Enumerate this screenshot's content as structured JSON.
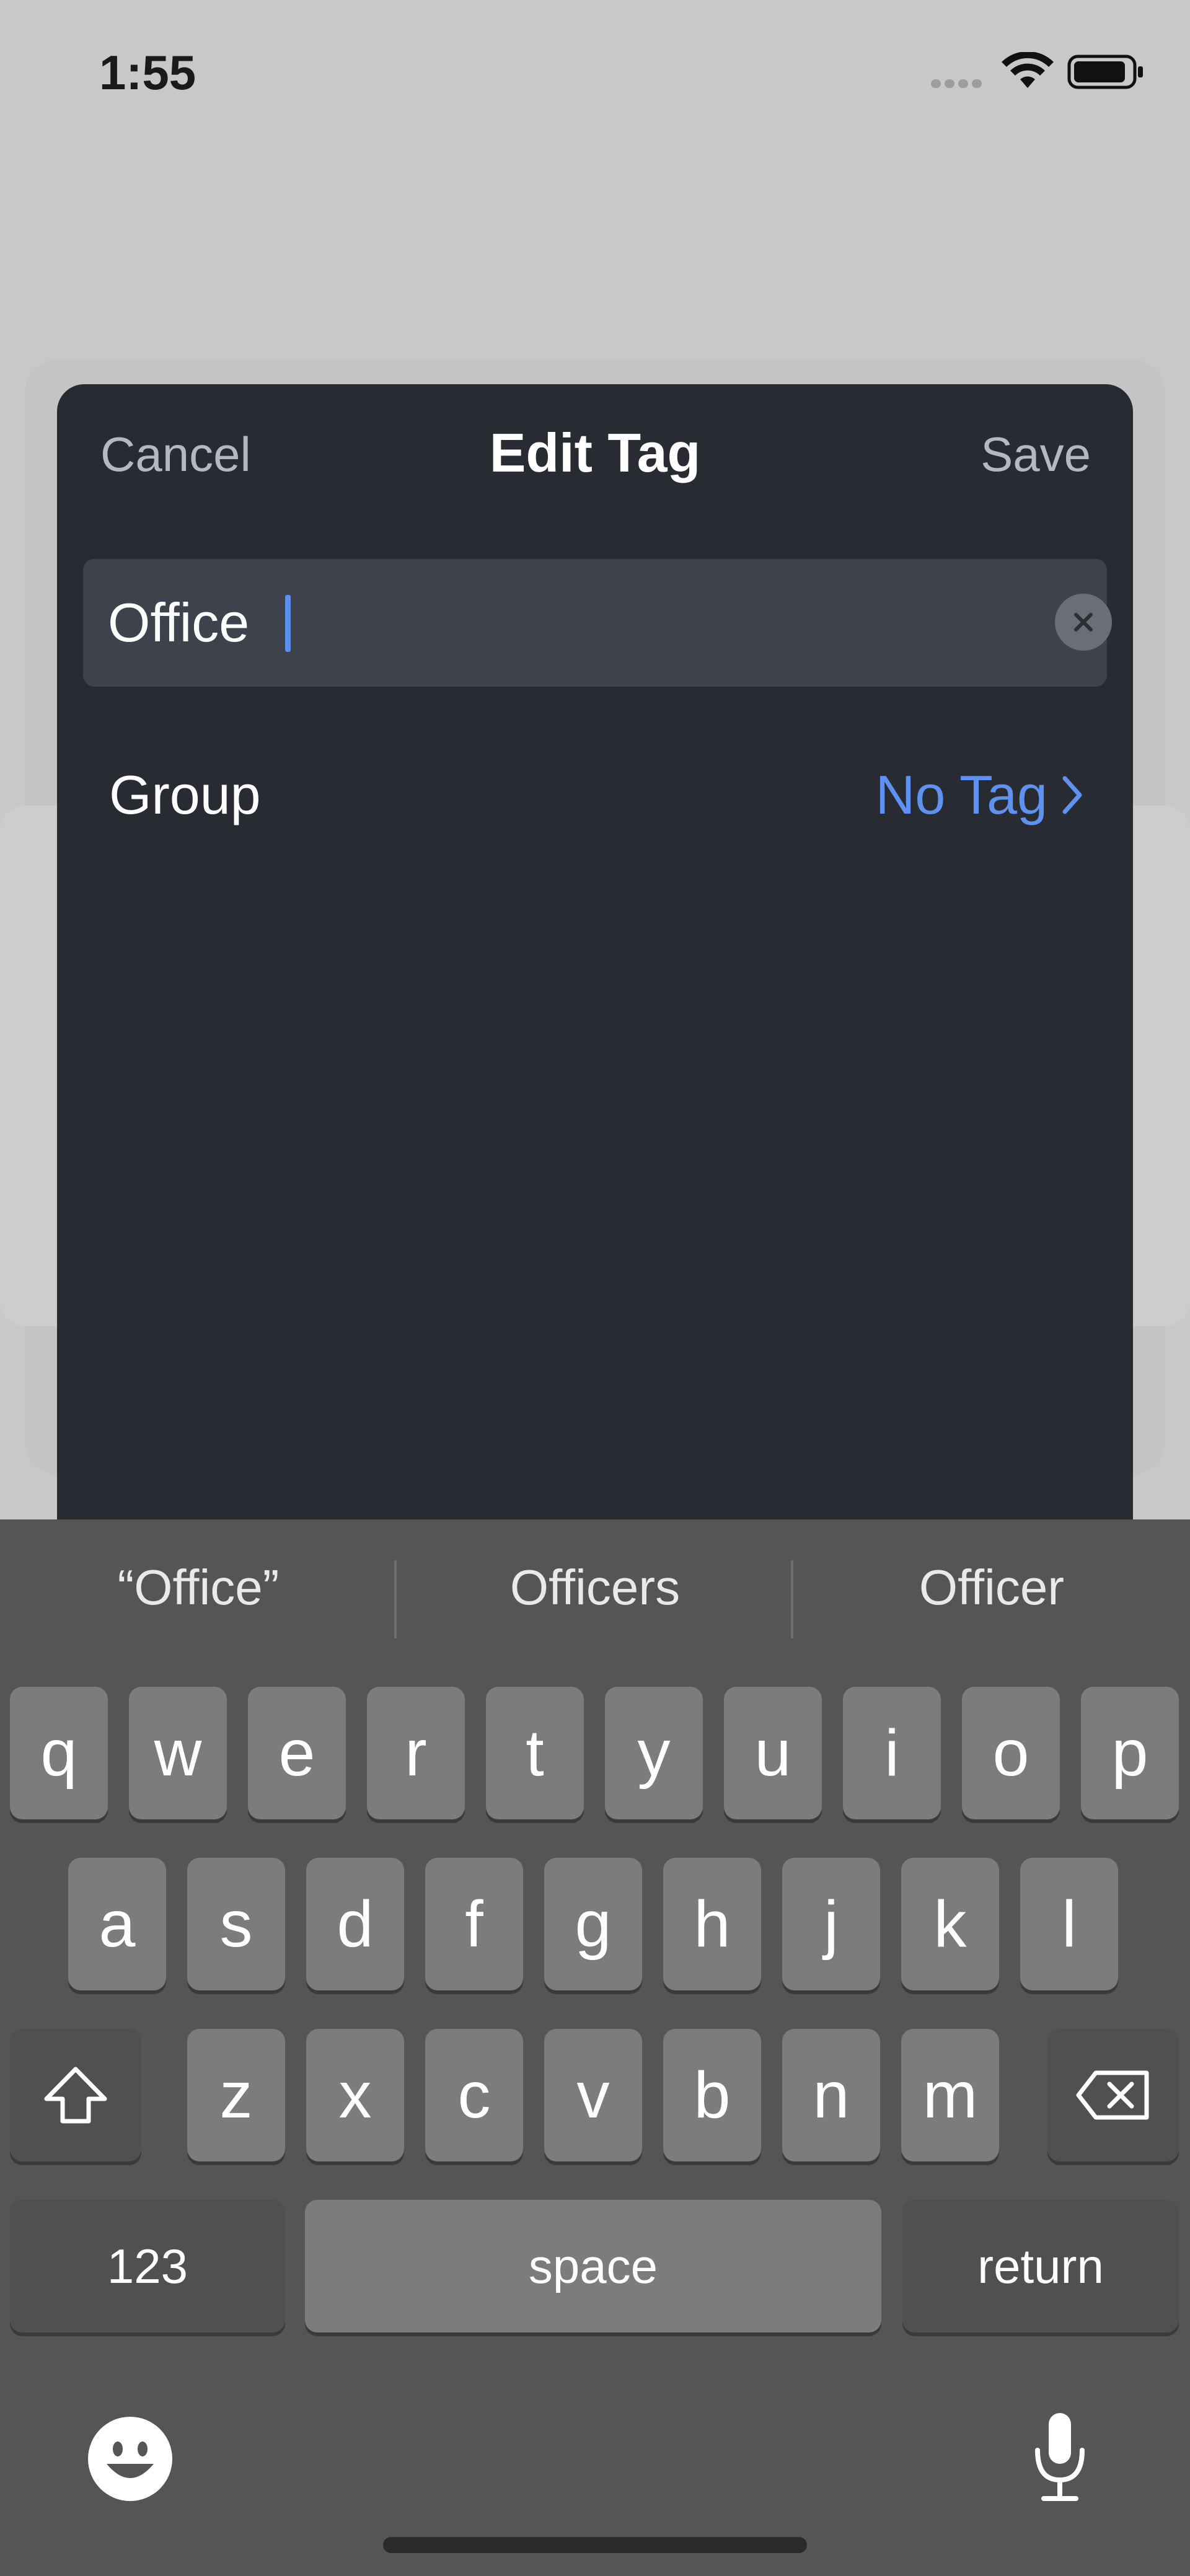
{
  "status": {
    "time": "1:55"
  },
  "sheet": {
    "cancel_label": "Cancel",
    "title": "Edit Tag",
    "save_label": "Save",
    "name_value": "Office",
    "group_label": "Group",
    "group_value": "No Tag"
  },
  "keyboard": {
    "suggestions": [
      "“Office”",
      "Officers",
      "Officer"
    ],
    "row1": [
      "q",
      "w",
      "e",
      "r",
      "t",
      "y",
      "u",
      "i",
      "o",
      "p"
    ],
    "row2": [
      "a",
      "s",
      "d",
      "f",
      "g",
      "h",
      "j",
      "k",
      "l"
    ],
    "row3": [
      "z",
      "x",
      "c",
      "v",
      "b",
      "n",
      "m"
    ],
    "numbers_label": "123",
    "space_label": "space",
    "return_label": "return"
  },
  "icons": {
    "emoji": "emoji-icon",
    "mic": "microphone-icon",
    "shift": "shift-icon",
    "delete": "delete-icon",
    "clear": "clear-icon",
    "chevron": "chevron-right-icon"
  }
}
